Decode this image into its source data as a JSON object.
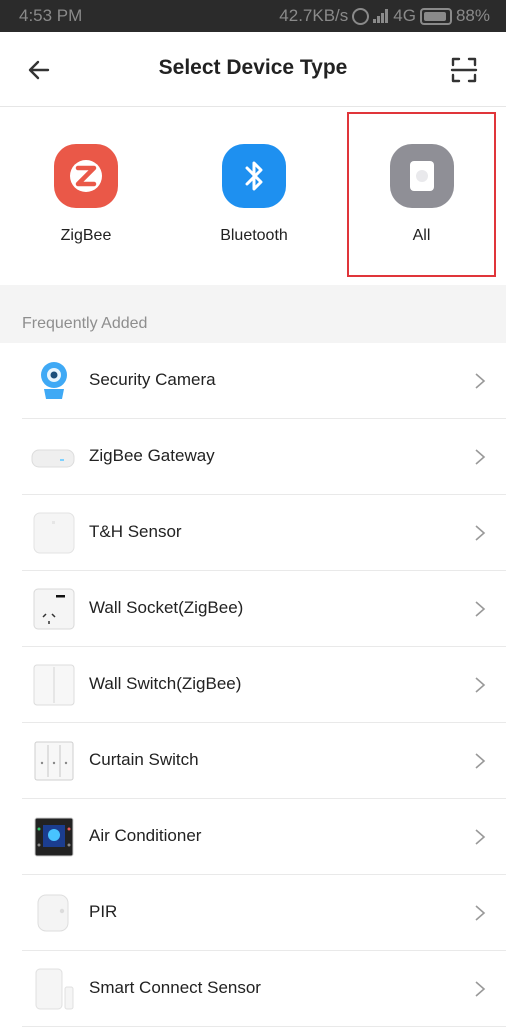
{
  "status_bar": {
    "time": "4:53 PM",
    "indicators": "42.7KB/s",
    "network": "4G",
    "battery": "88%"
  },
  "header": {
    "title": "Select Device Type",
    "back_icon": "arrow-left-icon",
    "scan_icon": "scan-icon"
  },
  "categories": [
    {
      "label": "ZigBee",
      "icon": "zigbee-icon",
      "color": "#ea5848"
    },
    {
      "label": "Bluetooth",
      "icon": "bluetooth-icon",
      "color": "#1e90f0"
    },
    {
      "label": "All",
      "icon": "all-devices-icon",
      "color": "#8f8f96",
      "selected": true
    }
  ],
  "section": {
    "title": "Frequently Added"
  },
  "devices": [
    {
      "name": "Security Camera",
      "icon": "security-camera-icon"
    },
    {
      "name": "ZigBee Gateway",
      "icon": "gateway-icon"
    },
    {
      "name": "T&H Sensor",
      "icon": "th-sensor-icon"
    },
    {
      "name": "Wall Socket(ZigBee)",
      "icon": "wall-socket-icon"
    },
    {
      "name": "Wall Switch(ZigBee)",
      "icon": "wall-switch-icon"
    },
    {
      "name": "Curtain Switch",
      "icon": "curtain-switch-icon"
    },
    {
      "name": "Air Conditioner",
      "icon": "air-conditioner-icon"
    },
    {
      "name": "PIR",
      "icon": "pir-icon"
    },
    {
      "name": "Smart Connect Sensor",
      "icon": "smart-connect-sensor-icon"
    }
  ],
  "colors": {
    "accent_selected_border": "#e0353a",
    "section_bg": "#f4f4f4"
  }
}
